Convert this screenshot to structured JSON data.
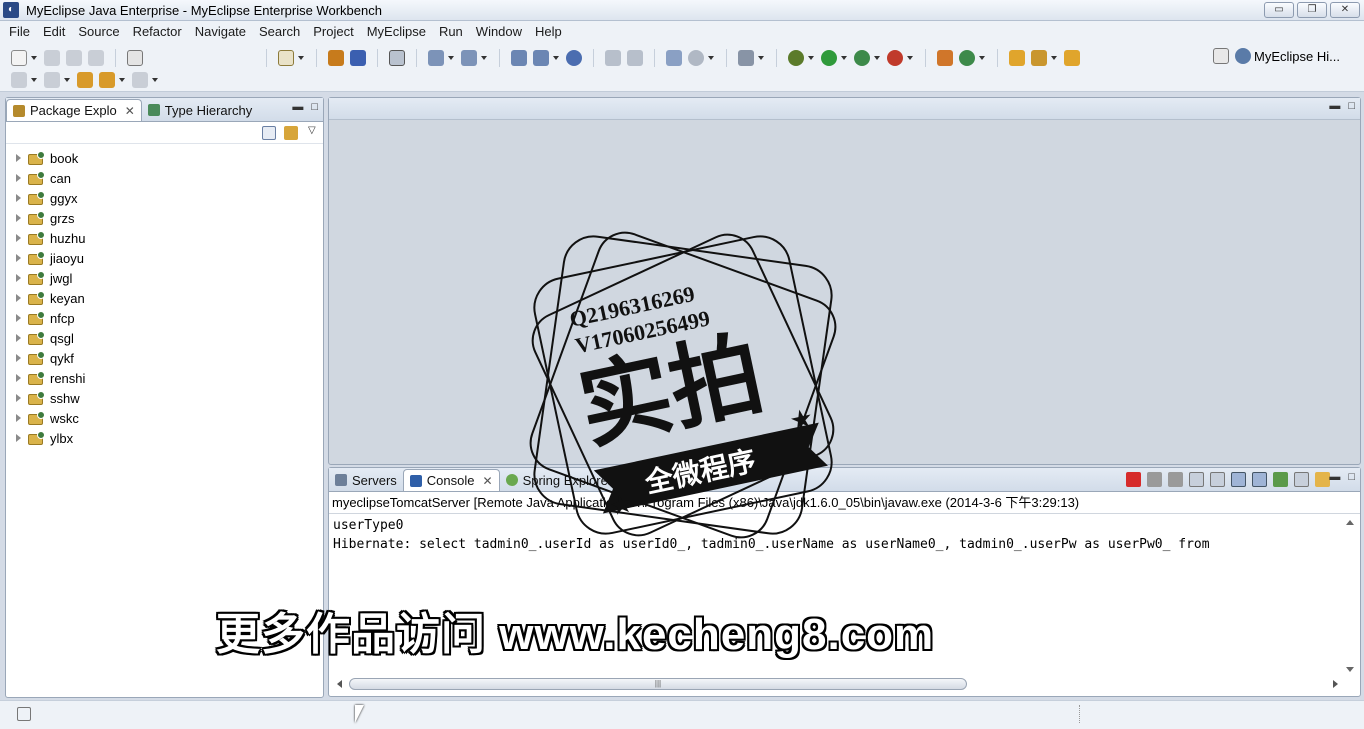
{
  "window": {
    "title": "MyEclipse Java Enterprise - MyEclipse Enterprise Workbench",
    "minimize": "▭",
    "maximize": "❐",
    "close": "✕"
  },
  "menu": [
    "File",
    "Edit",
    "Source",
    "Refactor",
    "Navigate",
    "Search",
    "Project",
    "MyEclipse",
    "Run",
    "Window",
    "Help"
  ],
  "perspective": {
    "label": "MyEclipse Hi..."
  },
  "left_panel": {
    "tabs": [
      {
        "label": "Package Explo",
        "active": true
      },
      {
        "label": "Type Hierarchy",
        "active": false
      }
    ],
    "projects": [
      "book",
      "can",
      "ggyx",
      "grzs",
      "huzhu",
      "jiaoyu",
      "jwgl",
      "keyan",
      "nfcp",
      "qsgl",
      "qykf",
      "renshi",
      "sshw",
      "wskc",
      "ylbx"
    ]
  },
  "console_panel": {
    "tabs": [
      {
        "label": "Servers",
        "active": false
      },
      {
        "label": "Console",
        "active": true
      },
      {
        "label": "Spring Explorer",
        "active": false
      }
    ],
    "description": "myeclipseTomcatServer [Remote Java Application] C:\\Program Files (x86)\\Java\\jdk1.6.0_05\\bin\\javaw.exe (2014-3-6 下午3:29:13)",
    "lines": [
      "userType0",
      "Hibernate: select tadmin0_.userId as userId0_, tadmin0_.userName as userName0_, tadmin0_.userPw as userPw0_ from"
    ],
    "scroll_thumb": "|||"
  },
  "watermark": {
    "contact_q": "Q2196316269",
    "contact_v": "V17060256499",
    "main": "实拍",
    "banner": "全微程序",
    "bottom": "更多作品访问 www.kecheng8.com"
  },
  "colors": {
    "frame": "#d4dbe6",
    "toolbar": "#eef2f7",
    "border": "#9aa7b8"
  }
}
